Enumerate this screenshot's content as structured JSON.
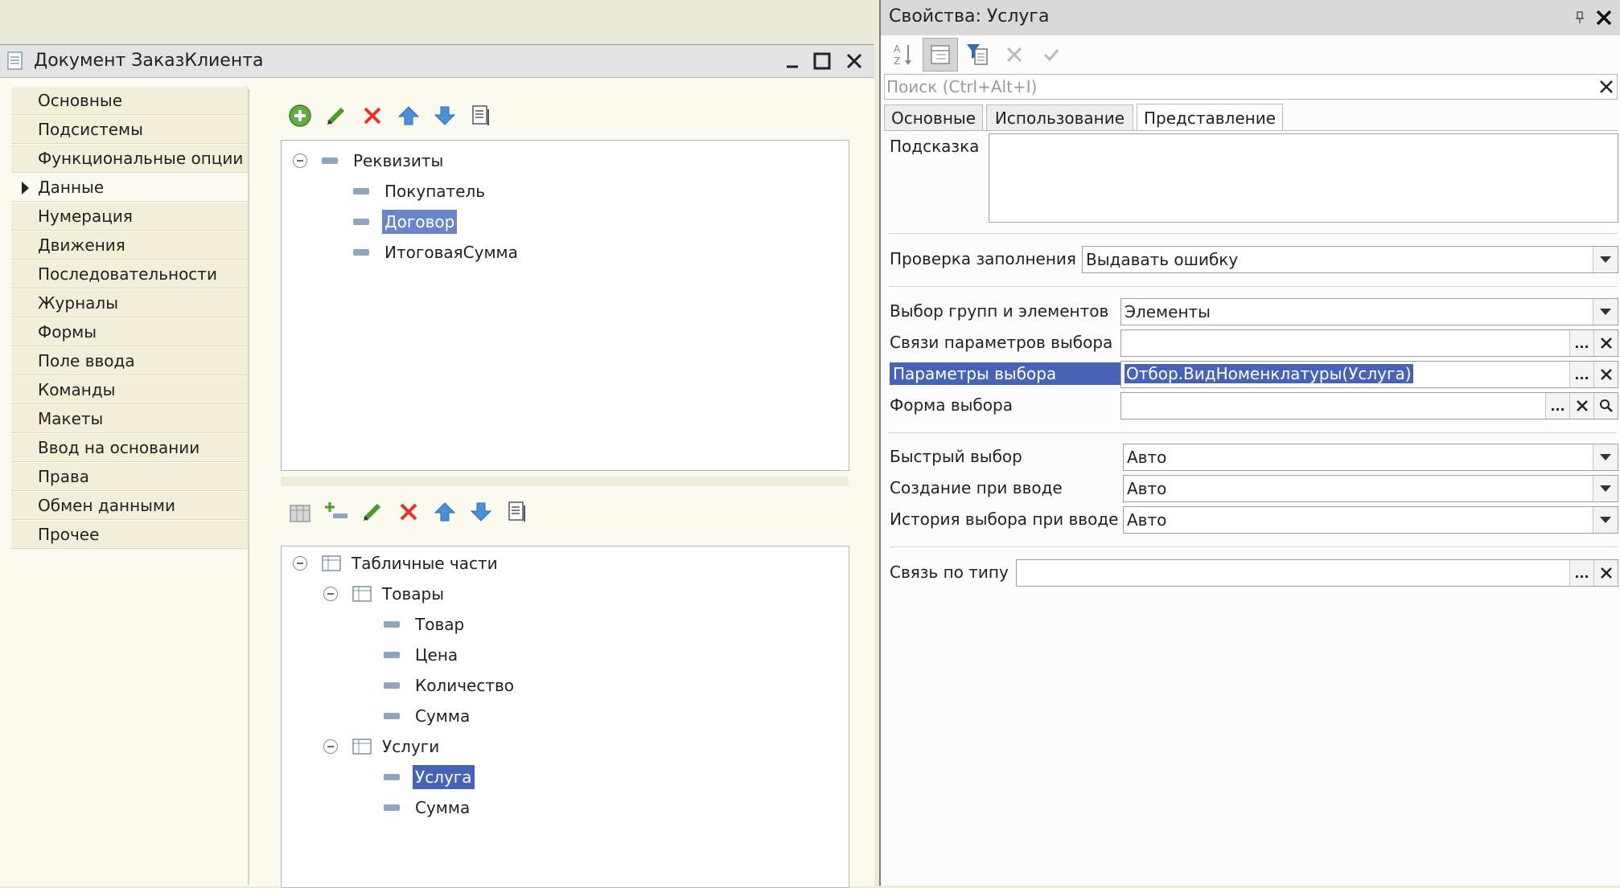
{
  "doc": {
    "title": "Документ ЗаказКлиента",
    "nav": [
      "Основные",
      "Подсистемы",
      "Функциональные опции",
      "Данные",
      "Нумерация",
      "Движения",
      "Последовательности",
      "Журналы",
      "Формы",
      "Поле ввода",
      "Команды",
      "Макеты",
      "Ввод на основании",
      "Права",
      "Обмен данными",
      "Прочее"
    ],
    "active_nav": "Данные",
    "attributes_tree": {
      "root": "Реквизиты",
      "items": [
        "Покупатель",
        "Договор",
        "ИтоговаяСумма"
      ],
      "selected": "Договор"
    },
    "tabular_tree": {
      "root": "Табличные части",
      "parts": [
        {
          "name": "Товары",
          "items": [
            "Товар",
            "Цена",
            "Количество",
            "Сумма"
          ]
        },
        {
          "name": "Услуги",
          "items": [
            "Услуга",
            "Сумма"
          ]
        }
      ],
      "selected": "Услуга"
    }
  },
  "props": {
    "title": "Свойства: Услуга",
    "search_placeholder": "Поиск (Ctrl+Alt+I)",
    "tabs": [
      "Основные",
      "Использование",
      "Представление"
    ],
    "active_tab": "Представление",
    "hint_label": "Подсказка",
    "hint_value": "",
    "fill_check_label": "Проверка заполнения",
    "fill_check_value": "Выдавать ошибку",
    "group_select_label": "Выбор групп и элементов",
    "group_select_value": "Элементы",
    "param_links_label": "Связи параметров выбора",
    "param_links_value": "",
    "choice_params_label": "Параметры выбора",
    "choice_params_value": "Отбор.ВидНоменклатуры(Услуга)",
    "choice_form_label": "Форма выбора",
    "choice_form_value": "",
    "quick_choice_label": "Быстрый выбор",
    "quick_choice_value": "Авто",
    "create_on_input_label": "Создание при вводе",
    "create_on_input_value": "Авто",
    "history_label": "История выбора при вводе",
    "history_value": "Авто",
    "type_link_label": "Связь по типу",
    "type_link_value": "",
    "ellipsis": "..."
  }
}
